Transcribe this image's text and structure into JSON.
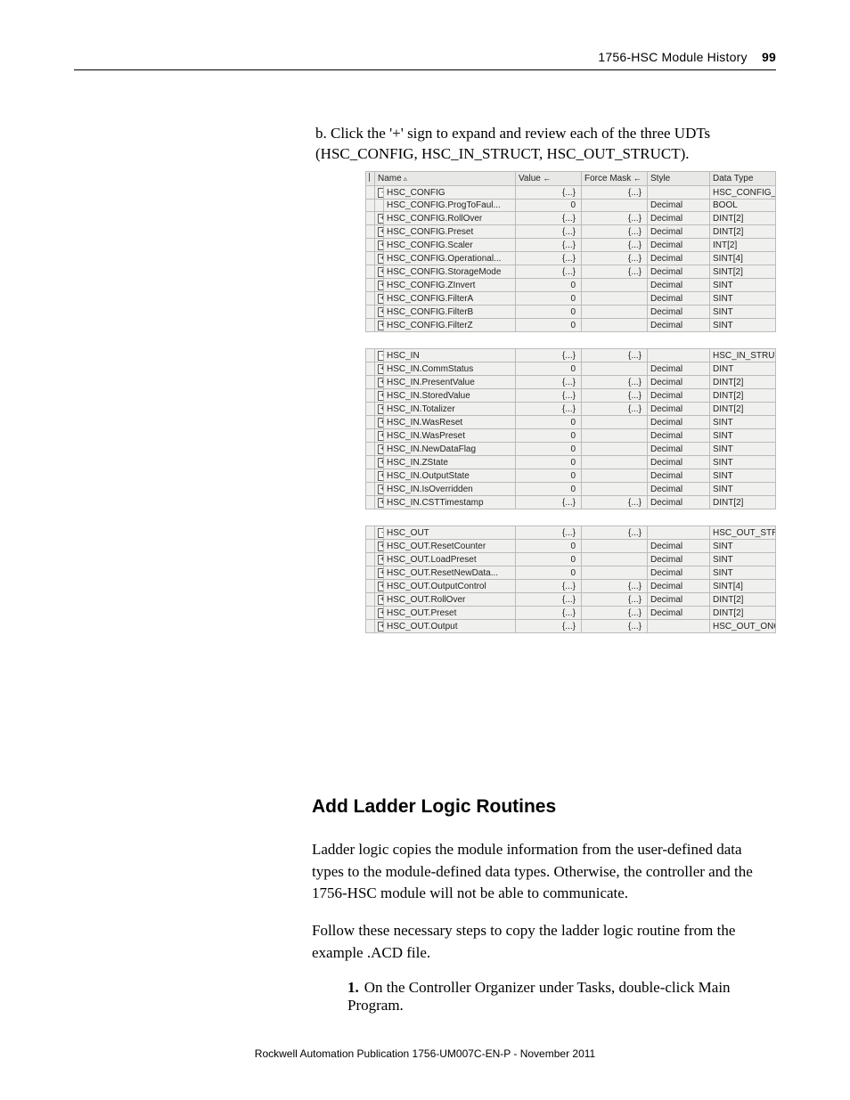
{
  "header": {
    "title": "1756-HSC Module History",
    "page_num": "99"
  },
  "instruction_b": "b. Click the '+' sign to expand and review each of the three UDTs (HSC_CONFIG, HSC_IN_STRUCT, HSC_OUT_STRUCT).",
  "table_headers": {
    "name": "Name",
    "value": "Value",
    "force_mask": "Force Mask",
    "style": "Style",
    "data_type": "Data Type"
  },
  "hsc_config": {
    "root": {
      "name": "HSC_CONFIG",
      "value": "{...}",
      "force": "{...}",
      "style": "",
      "dtype": "HSC_CONFIG_S..."
    },
    "rows": [
      {
        "icon": "",
        "name": "HSC_CONFIG.ProgToFaul...",
        "value": "0",
        "force": "",
        "style": "Decimal",
        "dtype": "BOOL"
      },
      {
        "icon": "+",
        "name": "HSC_CONFIG.RollOver",
        "value": "{...}",
        "force": "{...}",
        "style": "Decimal",
        "dtype": "DINT[2]"
      },
      {
        "icon": "+",
        "name": "HSC_CONFIG.Preset",
        "value": "{...}",
        "force": "{...}",
        "style": "Decimal",
        "dtype": "DINT[2]"
      },
      {
        "icon": "+",
        "name": "HSC_CONFIG.Scaler",
        "value": "{...}",
        "force": "{...}",
        "style": "Decimal",
        "dtype": "INT[2]"
      },
      {
        "icon": "+",
        "name": "HSC_CONFIG.Operational...",
        "value": "{...}",
        "force": "{...}",
        "style": "Decimal",
        "dtype": "SINT[4]"
      },
      {
        "icon": "+",
        "name": "HSC_CONFIG.StorageMode",
        "value": "{...}",
        "force": "{...}",
        "style": "Decimal",
        "dtype": "SINT[2]"
      },
      {
        "icon": "+",
        "name": "HSC_CONFIG.ZInvert",
        "value": "0",
        "force": "",
        "style": "Decimal",
        "dtype": "SINT"
      },
      {
        "icon": "+",
        "name": "HSC_CONFIG.FilterA",
        "value": "0",
        "force": "",
        "style": "Decimal",
        "dtype": "SINT"
      },
      {
        "icon": "+",
        "name": "HSC_CONFIG.FilterB",
        "value": "0",
        "force": "",
        "style": "Decimal",
        "dtype": "SINT"
      },
      {
        "icon": "+",
        "name": "HSC_CONFIG.FilterZ",
        "value": "0",
        "force": "",
        "style": "Decimal",
        "dtype": "SINT"
      }
    ]
  },
  "hsc_in": {
    "root": {
      "name": "HSC_IN",
      "value": "{...}",
      "force": "{...}",
      "style": "",
      "dtype": "HSC_IN_STRUCT"
    },
    "rows": [
      {
        "icon": "+",
        "name": "HSC_IN.CommStatus",
        "value": "0",
        "force": "",
        "style": "Decimal",
        "dtype": "DINT"
      },
      {
        "icon": "+",
        "name": "HSC_IN.PresentValue",
        "value": "{...}",
        "force": "{...}",
        "style": "Decimal",
        "dtype": "DINT[2]"
      },
      {
        "icon": "+",
        "name": "HSC_IN.StoredValue",
        "value": "{...}",
        "force": "{...}",
        "style": "Decimal",
        "dtype": "DINT[2]"
      },
      {
        "icon": "+",
        "name": "HSC_IN.Totalizer",
        "value": "{...}",
        "force": "{...}",
        "style": "Decimal",
        "dtype": "DINT[2]"
      },
      {
        "icon": "+",
        "name": "HSC_IN.WasReset",
        "value": "0",
        "force": "",
        "style": "Decimal",
        "dtype": "SINT"
      },
      {
        "icon": "+",
        "name": "HSC_IN.WasPreset",
        "value": "0",
        "force": "",
        "style": "Decimal",
        "dtype": "SINT"
      },
      {
        "icon": "+",
        "name": "HSC_IN.NewDataFlag",
        "value": "0",
        "force": "",
        "style": "Decimal",
        "dtype": "SINT"
      },
      {
        "icon": "+",
        "name": "HSC_IN.ZState",
        "value": "0",
        "force": "",
        "style": "Decimal",
        "dtype": "SINT"
      },
      {
        "icon": "+",
        "name": "HSC_IN.OutputState",
        "value": "0",
        "force": "",
        "style": "Decimal",
        "dtype": "SINT"
      },
      {
        "icon": "+",
        "name": "HSC_IN.IsOverridden",
        "value": "0",
        "force": "",
        "style": "Decimal",
        "dtype": "SINT"
      },
      {
        "icon": "+",
        "name": "HSC_IN.CSTTimestamp",
        "value": "{...}",
        "force": "{...}",
        "style": "Decimal",
        "dtype": "DINT[2]"
      }
    ]
  },
  "hsc_out": {
    "root": {
      "name": "HSC_OUT",
      "value": "{...}",
      "force": "{...}",
      "style": "",
      "dtype": "HSC_OUT_STRU..."
    },
    "rows": [
      {
        "icon": "+",
        "name": "HSC_OUT.ResetCounter",
        "value": "0",
        "force": "",
        "style": "Decimal",
        "dtype": "SINT"
      },
      {
        "icon": "+",
        "name": "HSC_OUT.LoadPreset",
        "value": "0",
        "force": "",
        "style": "Decimal",
        "dtype": "SINT"
      },
      {
        "icon": "+",
        "name": "HSC_OUT.ResetNewData...",
        "value": "0",
        "force": "",
        "style": "Decimal",
        "dtype": "SINT"
      },
      {
        "icon": "+",
        "name": "HSC_OUT.OutputControl",
        "value": "{...}",
        "force": "{...}",
        "style": "Decimal",
        "dtype": "SINT[4]"
      },
      {
        "icon": "+",
        "name": "HSC_OUT.RollOver",
        "value": "{...}",
        "force": "{...}",
        "style": "Decimal",
        "dtype": "DINT[2]"
      },
      {
        "icon": "+",
        "name": "HSC_OUT.Preset",
        "value": "{...}",
        "force": "{...}",
        "style": "Decimal",
        "dtype": "DINT[2]"
      },
      {
        "icon": "+",
        "name": "HSC_OUT.Output",
        "value": "{...}",
        "force": "{...}",
        "style": "",
        "dtype": "HSC_OUT_ONOF..."
      }
    ]
  },
  "section_heading": "Add Ladder Logic Routines",
  "para1": "Ladder logic copies the module information from the user-defined data types to the module-defined data types. Otherwise, the controller and the 1756-HSC module will not be able to communicate.",
  "para2": "Follow these necessary steps to copy the ladder logic routine from the example .ACD file.",
  "step1_num": "1.",
  "step1_text": "On the Controller Organizer under Tasks, double-click Main Program.",
  "footer": "Rockwell Automation Publication 1756-UM007C-EN-P - November 2011"
}
